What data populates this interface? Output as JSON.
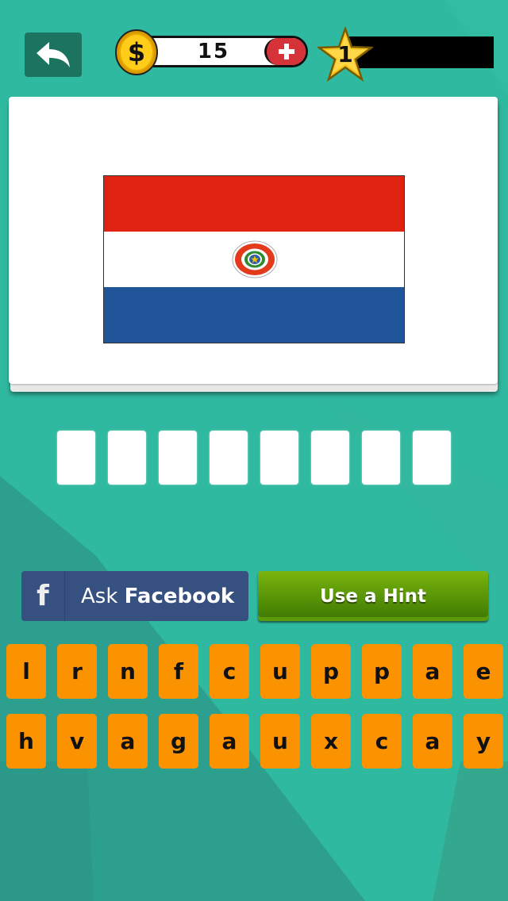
{
  "header": {
    "back_icon": "back-arrow-icon",
    "coins": "15",
    "coin_icon": "dollar-coin-icon",
    "add_coins_icon": "plus-icon",
    "level": "1",
    "level_icon": "star-icon"
  },
  "puzzle": {
    "flag": {
      "name": "Paraguay",
      "colors": [
        "#e02210",
        "#ffffff",
        "#20559a"
      ],
      "emblem_text": "REPUBLICA DEL PARAGUAY"
    },
    "answer_slots": [
      "",
      "",
      "",
      "",
      "",
      "",
      "",
      ""
    ]
  },
  "actions": {
    "facebook_prefix": "Ask ",
    "facebook_bold": "Facebook",
    "facebook_icon": "facebook-icon",
    "hint_label": "Use a Hint"
  },
  "keyboard": {
    "rows": [
      [
        "l",
        "r",
        "n",
        "f",
        "c",
        "u",
        "p",
        "p",
        "a",
        "e"
      ],
      [
        "h",
        "v",
        "a",
        "g",
        "a",
        "u",
        "x",
        "c",
        "a",
        "y"
      ]
    ]
  },
  "colors": {
    "background": "#2fb9a0",
    "key": "#fb9300",
    "facebook": "#36507f",
    "hint": "#5c9a07"
  }
}
